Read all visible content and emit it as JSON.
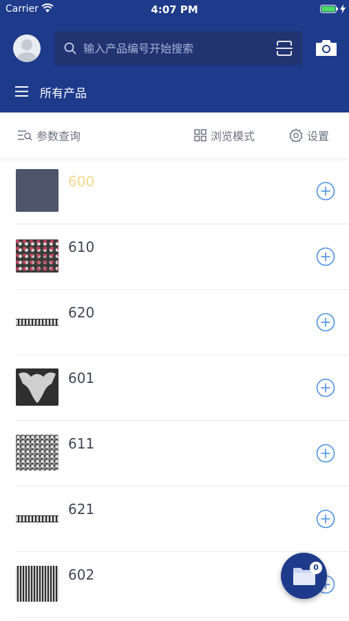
{
  "status_bar": {
    "carrier": "Carrier",
    "time": "4:07 PM"
  },
  "header": {
    "search_placeholder": "输入产品编号开始搜索",
    "nav_title": "所有产品"
  },
  "toolbar": {
    "params_label": "参数查询",
    "browse_label": "浏览模式",
    "settings_label": "设置"
  },
  "products": [
    {
      "code": "600",
      "thumbnail": "solid-slate"
    },
    {
      "code": "610",
      "thumbnail": "floral"
    },
    {
      "code": "620",
      "thumbnail": "trim"
    },
    {
      "code": "601",
      "thumbnail": "applique"
    },
    {
      "code": "611",
      "thumbnail": "lace"
    },
    {
      "code": "621",
      "thumbnail": "trim"
    },
    {
      "code": "602",
      "thumbnail": "stripes"
    }
  ],
  "cart": {
    "count": "0"
  },
  "colors": {
    "brand": "#1e3a8a",
    "accent": "#4a90e2",
    "selected_code": "#f3d98c"
  },
  "icons": [
    "wifi-icon",
    "battery-icon",
    "search-icon",
    "scan-icon",
    "camera-icon",
    "menu-icon",
    "filter-icon",
    "grid-icon",
    "gear-icon",
    "add-circle-icon",
    "folder-icon"
  ]
}
